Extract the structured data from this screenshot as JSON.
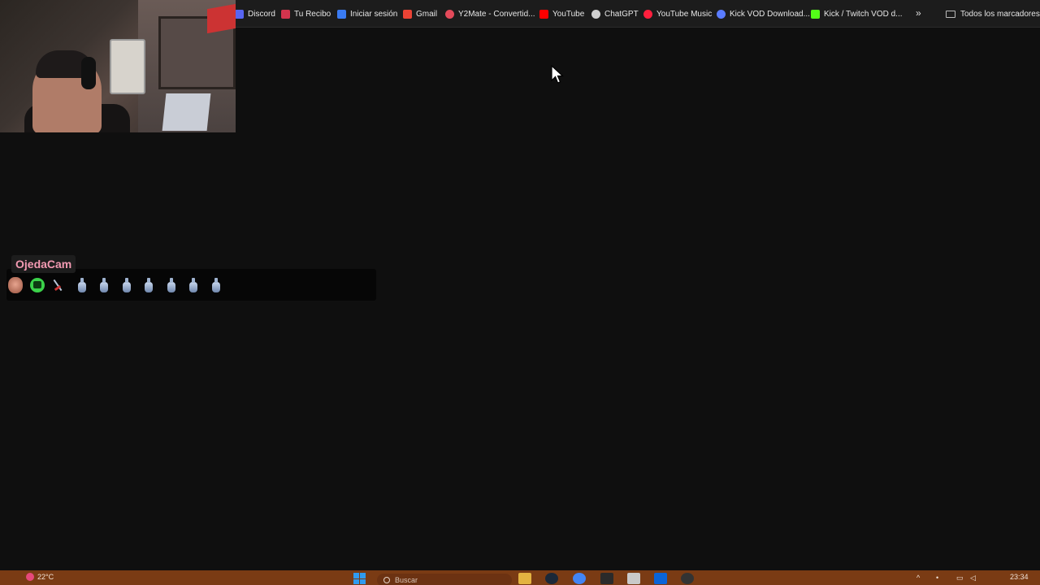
{
  "bookmarks": [
    {
      "label": "Discord",
      "icon": "discord-icon",
      "color": "#5865f2"
    },
    {
      "label": "Tu Recibo",
      "icon": "tu-recibo-icon",
      "color": "#d2344d"
    },
    {
      "label": "Iniciar sesión",
      "icon": "login-icon",
      "color": "#3a7bf2"
    },
    {
      "label": "Gmail",
      "icon": "gmail-icon",
      "color": "#ea4335"
    },
    {
      "label": "Y2Mate - Convertid...",
      "icon": "y2mate-icon",
      "color": "#e34a5a"
    },
    {
      "label": "YouTube",
      "icon": "youtube-icon",
      "color": "#ff0000"
    },
    {
      "label": "ChatGPT",
      "icon": "chatgpt-icon",
      "color": "#cfcfcf"
    },
    {
      "label": "YouTube Music",
      "icon": "youtube-music-icon",
      "color": "#ff1f3d"
    },
    {
      "label": "Kick VOD Download...",
      "icon": "kick-vod-icon",
      "color": "#5a7cff"
    },
    {
      "label": "Kick / Twitch VOD d...",
      "icon": "kick-twitch-icon",
      "color": "#53fc18"
    }
  ],
  "bookmarks_more": "»",
  "bookmarks_all": "Todos los marcadores",
  "chat": {
    "username": "OjedaCam",
    "username_color": "#f39ab2"
  },
  "taskbar": {
    "weather": "22°C",
    "search_placeholder": "Buscar",
    "clock": "23:34",
    "color": "#7a3b14"
  }
}
